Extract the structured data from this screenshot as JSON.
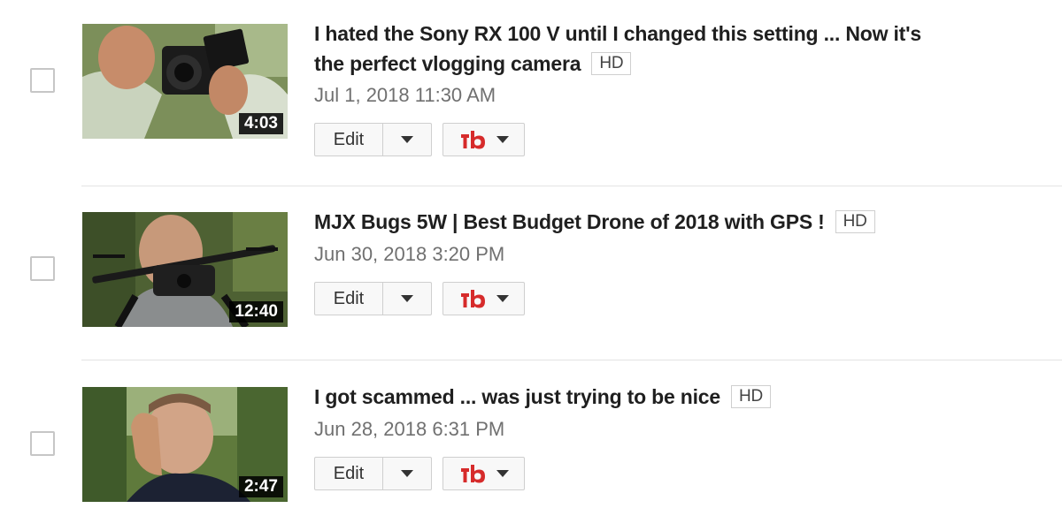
{
  "videos": [
    {
      "title": "I hated the Sony RX 100 V until I changed this setting ... Now it's",
      "title_line2": "the perfect vlogging camera",
      "quality_badge": "HD",
      "date": "Jul 1, 2018 11:30 AM",
      "duration": "4:03",
      "edit_label": "Edit"
    },
    {
      "title": "MJX Bugs 5W | Best Budget Drone of 2018 with GPS !",
      "quality_badge": "HD",
      "date": "Jun 30, 2018 3:20 PM",
      "duration": "12:40",
      "edit_label": "Edit"
    },
    {
      "title": "I got scammed ... was just trying to be nice",
      "quality_badge": "HD",
      "date": "Jun 28, 2018 6:31 PM",
      "duration": "2:47",
      "edit_label": "Edit"
    }
  ],
  "icons": {
    "dropdown": "chevron-down-icon",
    "tubebuddy": "tubebuddy-logo-icon"
  },
  "colors": {
    "tubebuddy_red": "#d62b2b",
    "duration_bg": "#000000",
    "date_text": "#707070"
  }
}
